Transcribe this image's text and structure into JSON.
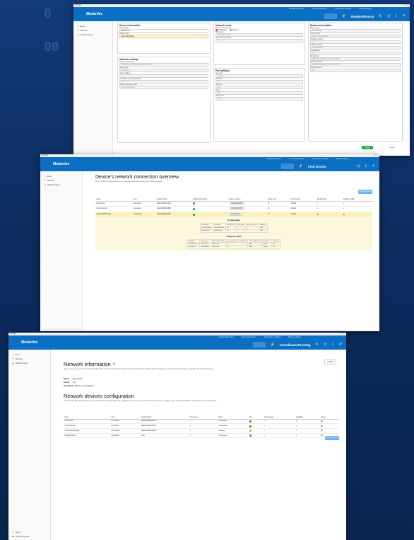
{
  "w1": {
    "title": "Settings",
    "header_tabs": [
      "Configuration panel",
      "Connected devices",
      "Synchronize network",
      "Modem settings"
    ],
    "selected_device": "NewEndDevice",
    "sidebar": [
      "Home",
      "Network",
      "Network cloud"
    ],
    "device_information": {
      "title": "Device information",
      "name_label": "Device name",
      "name_value": "First Device",
      "notes_label": "Device notes",
      "notes_placeholder": "Device description"
    },
    "network_settings": {
      "title": "Network settings",
      "key_label": "Network security key",
      "key_value": "41728D0CFF1D364B9EF0F5B29C36EB3C",
      "role_label": "Device type",
      "role_value": "End device",
      "addr_label": "Device address",
      "addr_value": "1",
      "chain_label": "Connection chain (end-device)",
      "chain_value": "32",
      "conn_label": "Device connection mode",
      "conn_value": "Set as interlocked"
    },
    "network_mode": {
      "title": "Network mode",
      "modem_label": "Device network mode",
      "opt1": "Transparent",
      "opt2": "Wireless",
      "pan_label": "PAN mode",
      "pan_value": "Broadcast address",
      "retry_label": "Retry (0-10 per frame)",
      "retry_value": "3"
    },
    "port_settings": {
      "title": "Port settings",
      "baud_label": "Baud rate",
      "baud_value": "115200",
      "data_label": "Data bits",
      "data_value": "8",
      "stop_label": "Stop bits",
      "stop_value": "One",
      "parity_label": "Parity",
      "parity_value": "None",
      "flow_label": "Flow control",
      "flow_value": "None"
    },
    "modem_information": {
      "title": "Modem information",
      "model_label": "Modem type",
      "model_value": "GX 702 2002",
      "serial_label": "Serial number",
      "serial_value": "0E0A4C0D8C2A04DA",
      "hw_label": "Hardware version",
      "hw_value": "1.0",
      "sw_label": "Software version",
      "sw_value": "1.2.0094.00R19",
      "cfg_label": "Configuration",
      "cfg_value": "3.4",
      "mac_label": "Mfr address",
      "mac_value": "4E0C9E4F1FE4B8 modem HAEA0774",
      "mod2_label": "Physical address",
      "mod2_value": "4E0C9E4F1FE4B8 modem HAEA0774",
      "freq_label": "Frequency band",
      "freq_value": "433"
    },
    "save": "Save",
    "cancel": "Cancel"
  },
  "w2": {
    "title": "Settings",
    "header_tabs": [
      "Configuration panel",
      "Connected devices",
      "Synchronize network",
      "Modem settings"
    ],
    "selected_device": "First Device",
    "sidebar": [
      "Home",
      "Network",
      "Network cloud"
    ],
    "heading": "Device's network connection overview",
    "subtitle": "Here you can see what devices are connected and their routing and neighbour tables",
    "add_label": "Add a new device",
    "columns": [
      "Name",
      "Type",
      "Serial number",
      "Network connection",
      "Route to device",
      "Route Cost",
      "From Hexdcd",
      "Routing table",
      "Neighbour table"
    ],
    "rows": [
      {
        "name": "First Device",
        "type": "End device",
        "serial": "0E0A4C0D8C2A04",
        "route": "Coordinator/Firs",
        "cost": "11",
        "from": "0x2A04",
        "rt": "≡",
        "nt": "≡"
      },
      {
        "name": "Second Device",
        "type": "End device",
        "serial": "0E0A4C0D8C2B02",
        "route": "Coordinator/Firs",
        "cost": "10",
        "from": "0x2A04",
        "rt": "≡",
        "nt": "≡"
      },
      {
        "name": "CoordinatorPresetlg",
        "type": "Coordinator",
        "serial": "0E0A4C0D8C2A03",
        "route": "First Device",
        "cost": "11",
        "from": "0x2A04",
        "rt": "⇆",
        "nt": "⇆"
      }
    ],
    "routing_title": "Routing table",
    "routing_cols": [
      "Destination",
      "Next hop",
      "Route cost",
      "Hop count",
      "Weak link count",
      "Valid time"
    ],
    "routing_rows": [
      [
        "Second Device",
        "Second Device",
        "10",
        "1",
        "0",
        "1733"
      ],
      [
        "First Device",
        "First Device",
        "11",
        "1",
        "0",
        "1733"
      ]
    ],
    "neighbour_title": "Neighbour table",
    "neighbour_cols": [
      "Neighbour",
      "Tone map",
      "Payload modulation",
      "Link quality to the neighbour",
      "Phase differential",
      "Modulation",
      "Valid time"
    ],
    "neighbour_rows": [
      [
        "Second Device",
        "0x003 TFP",
        "Differential",
        "0",
        "2880",
        "QPSK",
        "15"
      ],
      [
        "First Device",
        "0x003 8EPE",
        "Differential",
        "0",
        "2880",
        "Robust",
        "14"
      ]
    ]
  },
  "w3": {
    "title": "Settings",
    "header_tabs": [
      "Configuration panel",
      "Connected devices",
      "Synchronize network",
      "Modem settings"
    ],
    "selected_device": "CoordinatorPresetlg",
    "sidebar": [
      "Home",
      "Network",
      "Network cloud"
    ],
    "sidebar_bottom": [
      "About",
      "Switch language"
    ],
    "heading": "Network information",
    "subtitle": "Here you can see your current network information. If you wish to edit them click on the pencil icon. This network will be created once a network device of type coordinator will be synchronized.",
    "export": "Export",
    "name_label": "Name:",
    "name_value": "My Network",
    "panid_label": "Pan ID:",
    "panid_value": "112",
    "desc_label": "Description:",
    "desc_value": "This is a demonstration",
    "cfg_heading": "Network devices configuration",
    "cfg_subtitle": "Overview of what network devices are in the network, their last state and configuration. Here you can add new network devices, configure them for synchronization, or delete them from the network.",
    "add_label": "Add a new device",
    "columns": [
      "Name",
      "Type",
      "Serial number",
      "Check time",
      "Mode",
      "Role",
      "Port settings",
      "View/Edit",
      "Delete"
    ],
    "rows": [
      {
        "name": "First Device",
        "type": "End device",
        "serial": "0E0A4C0D8C2F72D",
        "check": "1",
        "mode": "Transparent",
        "role": "g"
      },
      {
        "name": "Second Device",
        "type": "End device",
        "serial": "0E0A4C0D8C2F0C7",
        "check": "1",
        "mode": "Transparent",
        "role": "g"
      },
      {
        "name": "CoordinatorPresetlg",
        "type": "Coordinator",
        "serial": "0E0A4C0D8C18C88",
        "check": "1",
        "mode": "Wireless",
        "role": "o"
      },
      {
        "name": "NewEndDevice",
        "type": "End device",
        "serial": "None",
        "check": "1",
        "mode": "Transparent",
        "role": "r"
      }
    ]
  }
}
